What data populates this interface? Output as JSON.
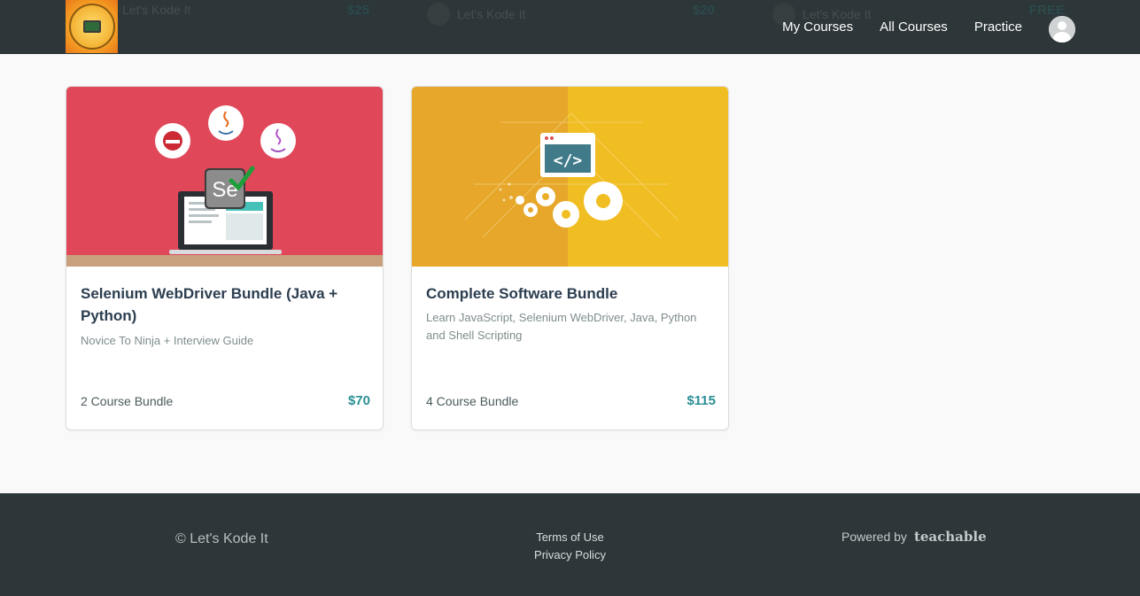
{
  "header": {
    "ghost_items": [
      {
        "label": "Let's Kode It",
        "price": "$25"
      },
      {
        "label": "Let's Kode It",
        "price": "$20"
      },
      {
        "label": "Let's Kode It",
        "price": "FREE"
      }
    ],
    "nav": [
      "My Courses",
      "All Courses",
      "Practice"
    ]
  },
  "cards": [
    {
      "title": "Selenium WebDriver Bundle (Java + Python)",
      "subtitle": "Novice To Ninja + Interview Guide",
      "bundle": "2 Course Bundle",
      "price": "$70",
      "thumb_color": "#e0485a"
    },
    {
      "title": "Complete Software Bundle",
      "subtitle": "Learn JavaScript, Selenium WebDriver, Java, Python and Shell Scripting",
      "bundle": "4 Course Bundle",
      "price": "$115",
      "thumb_color": "#f0bb24"
    }
  ],
  "footer": {
    "copyright": "© Let's Kode It",
    "links": [
      "Terms of Use",
      "Privacy Policy"
    ],
    "powered_by": "Powered by",
    "platform": "teachable"
  },
  "colors": {
    "header_bg": "#2d3638",
    "accent_price": "#2a8f95"
  },
  "icons": [
    "logo-icon",
    "avatar-icon",
    "java-icon",
    "selenium-icon",
    "redhat-icon",
    "code-window-icon",
    "gear-icon"
  ]
}
